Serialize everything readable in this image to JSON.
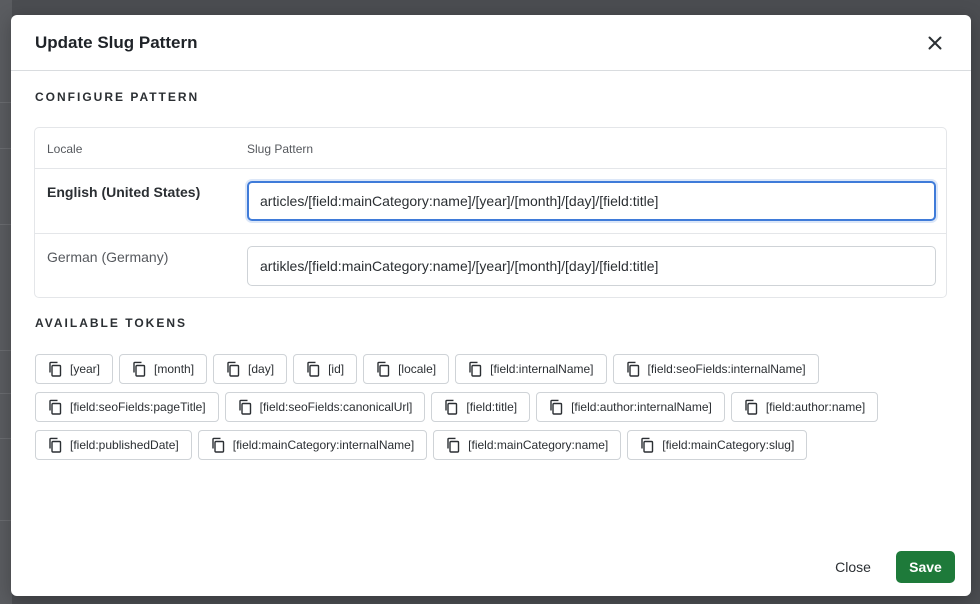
{
  "modal": {
    "title": "Update Slug Pattern",
    "close_icon": "close-icon"
  },
  "configure": {
    "heading": "CONFIGURE PATTERN",
    "columns": {
      "locale": "Locale",
      "pattern": "Slug Pattern"
    },
    "rows": [
      {
        "locale": "English (United States)",
        "value": "articles/[field:mainCategory:name]/[year]/[month]/[day]/[field:title]",
        "focused": true
      },
      {
        "locale": "German (Germany)",
        "value": "artikles/[field:mainCategory:name]/[year]/[month]/[day]/[field:title]",
        "focused": false
      }
    ]
  },
  "tokens": {
    "heading": "AVAILABLE TOKENS",
    "icon": "copy-icon",
    "items": [
      "[year]",
      "[month]",
      "[day]",
      "[id]",
      "[locale]",
      "[field:internalName]",
      "[field:seoFields:internalName]",
      "[field:seoFields:pageTitle]",
      "[field:seoFields:canonicalUrl]",
      "[field:title]",
      "[field:author:internalName]",
      "[field:author:name]",
      "[field:publishedDate]",
      "[field:mainCategory:internalName]",
      "[field:mainCategory:name]",
      "[field:mainCategory:slug]"
    ]
  },
  "footer": {
    "close_label": "Close",
    "save_label": "Save"
  },
  "colors": {
    "save_button": "#1e7a3a",
    "focus_ring": "#3f7bd9",
    "overlay": "#4a4c50"
  }
}
